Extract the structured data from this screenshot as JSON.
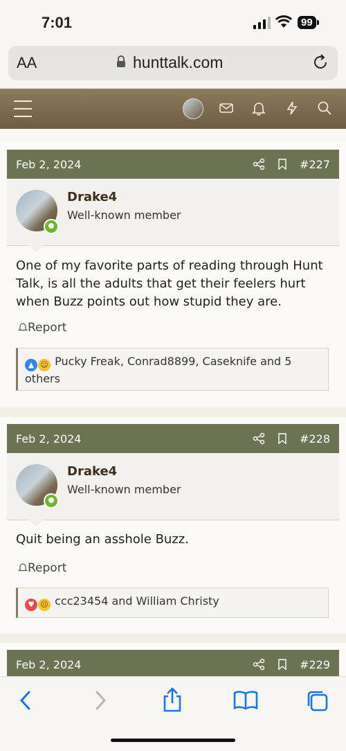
{
  "status_bar": {
    "time": "7:01",
    "battery": "99"
  },
  "browser": {
    "text_size_label": "AA",
    "url": "hunttalk.com"
  },
  "posts": [
    {
      "date": "Feb 2, 2024",
      "number": "#227",
      "username": "Drake4",
      "user_title": "Well-known member",
      "message": "One of my favorite parts of reading through Hunt Talk, is all the adults that get their feelers hurt when Buzz points out how stupid they are.",
      "report_label": "Report",
      "reactions_text": "Pucky Freak, Conrad8899, Caseknife and 5 others"
    },
    {
      "date": "Feb 2, 2024",
      "number": "#228",
      "username": "Drake4",
      "user_title": "Well-known member",
      "message": "Quit being an asshole Buzz.",
      "report_label": "Report",
      "reactions_text": "ccc23454 and William Christy"
    },
    {
      "date": "Feb 2, 2024",
      "number": "#229"
    }
  ],
  "colors": {
    "post_header": "#6b7353",
    "nav": "#7d6b4f",
    "ios_blue": "#1a73e8"
  }
}
